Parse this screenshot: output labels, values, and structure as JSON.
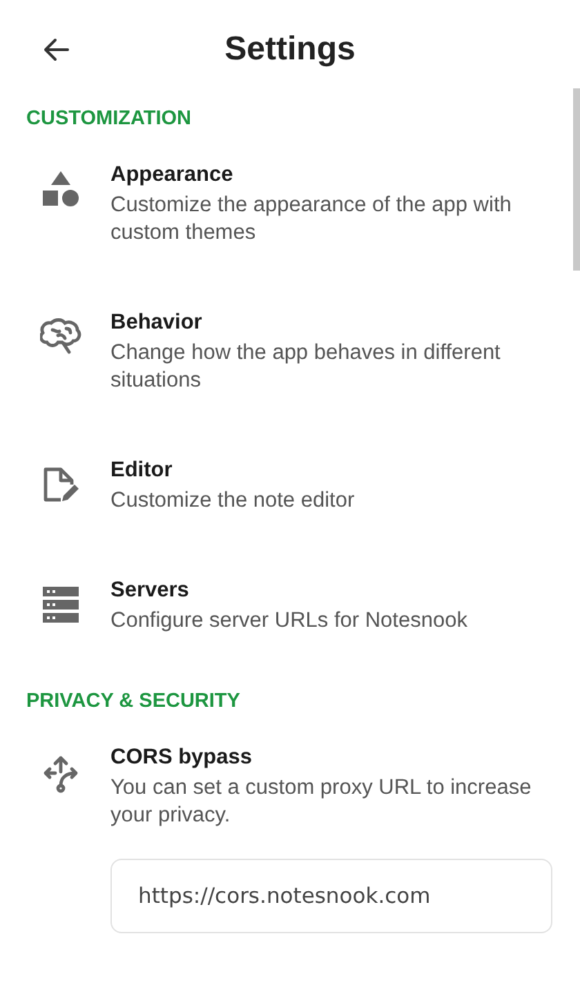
{
  "header": {
    "title": "Settings"
  },
  "sections": [
    {
      "title": "CUSTOMIZATION",
      "items": [
        {
          "kind": "shapes",
          "title": "Appearance",
          "description": "Customize the appearance of the app with custom themes"
        },
        {
          "kind": "brain",
          "title": "Behavior",
          "description": "Change how the app behaves in different situations"
        },
        {
          "kind": "editor",
          "title": "Editor",
          "description": "Customize the note editor"
        },
        {
          "kind": "servers",
          "title": "Servers",
          "description": "Configure server URLs for Notesnook"
        }
      ]
    },
    {
      "title": "PRIVACY & SECURITY",
      "items": [
        {
          "kind": "proxy",
          "title": "CORS bypass",
          "description": "You can set a custom proxy URL to increase your privacy.",
          "value": "https://cors.notesnook.com"
        }
      ]
    }
  ]
}
